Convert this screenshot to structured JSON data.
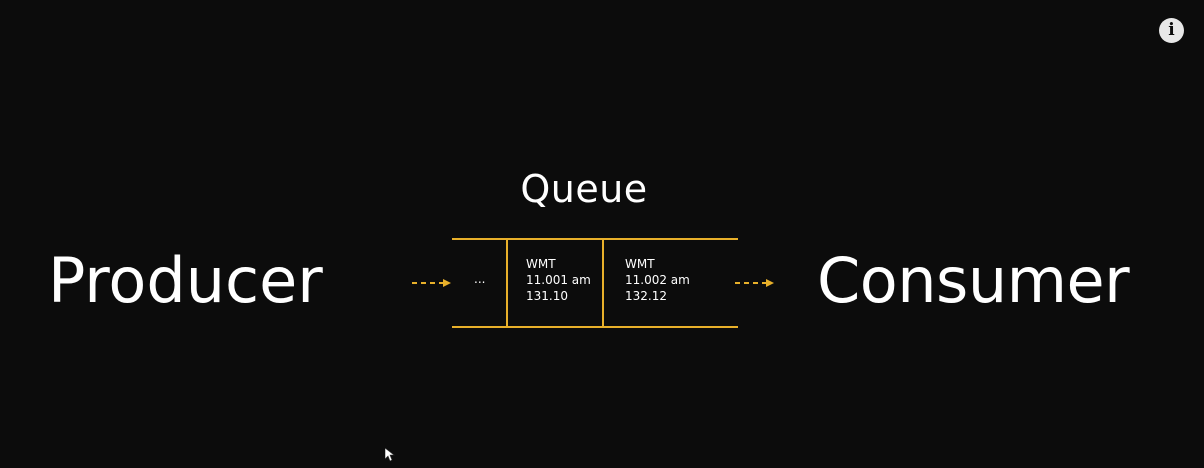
{
  "info_icon": {
    "glyph": "i"
  },
  "diagram": {
    "queue_label": "Queue",
    "producer_label": "Producer",
    "consumer_label": "Consumer",
    "ellipsis": "...",
    "messages": [
      {
        "symbol": "WMT",
        "time": "11.001 am",
        "price": "131.10"
      },
      {
        "symbol": "WMT",
        "time": "11.002 am",
        "price": "132.12"
      }
    ],
    "accent_color": "#e8b02a",
    "background_color": "#0c0c0c"
  }
}
